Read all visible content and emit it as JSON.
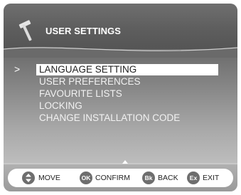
{
  "header": {
    "title": "USER SETTINGS",
    "icon": "hammer-icon"
  },
  "menu": {
    "cursor": ">",
    "items": [
      {
        "label": "LANGUAGE SETTING",
        "selected": true
      },
      {
        "label": "USER PREFERENCES",
        "selected": false
      },
      {
        "label": "FAVOURITE LISTS",
        "selected": false
      },
      {
        "label": "LOCKING",
        "selected": false
      },
      {
        "label": "CHANGE INSTALLATION CODE",
        "selected": false
      }
    ]
  },
  "footer": {
    "hints": [
      {
        "icon": "up-down-arrows-icon",
        "icon_text": "",
        "label": "MOVE"
      },
      {
        "icon": "ok-button-icon",
        "icon_text": "OK",
        "label": "CONFIRM"
      },
      {
        "icon": "back-button-icon",
        "icon_text": "Bk",
        "label": "BACK"
      },
      {
        "icon": "exit-button-icon",
        "icon_text": "Ex",
        "label": "EXIT"
      }
    ]
  },
  "colors": {
    "header_bg": "#5e5e5e",
    "highlight_bg": "#ffffff",
    "menu_text": "#f2f2f2",
    "footer_icon": "#6e6e6e"
  }
}
